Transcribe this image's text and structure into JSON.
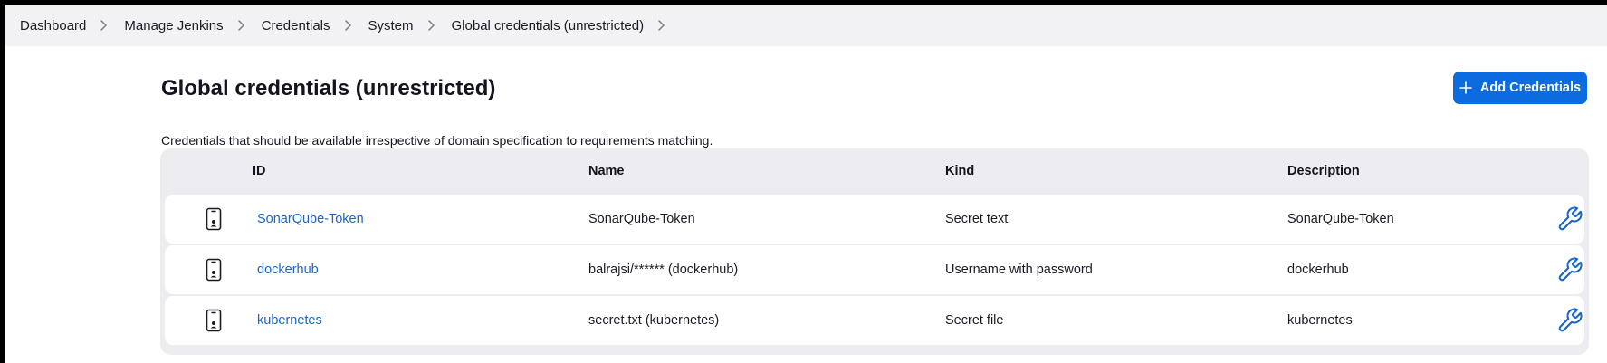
{
  "breadcrumb": {
    "items": [
      {
        "label": "Dashboard"
      },
      {
        "label": "Manage Jenkins"
      },
      {
        "label": "Credentials"
      },
      {
        "label": "System"
      },
      {
        "label": "Global credentials (unrestricted)"
      }
    ]
  },
  "header": {
    "title": "Global credentials (unrestricted)",
    "add_button_label": "Add Credentials",
    "add_button_icon": "plus-icon"
  },
  "description": "Credentials that should be available irrespective of domain specification to requirements matching.",
  "table": {
    "columns": [
      "ID",
      "Name",
      "Kind",
      "Description"
    ],
    "rows": [
      {
        "id": "SonarQube-Token",
        "name": "SonarQube-Token",
        "kind": "Secret text",
        "description": "SonarQube-Token",
        "icon": "credential-phone-icon",
        "action_icon": "wrench-icon"
      },
      {
        "id": "dockerhub",
        "name": "balrajsi/****** (dockerhub)",
        "kind": "Username with password",
        "description": "dockerhub",
        "icon": "credential-phone-icon",
        "action_icon": "wrench-icon"
      },
      {
        "id": "kubernetes",
        "name": "secret.txt (kubernetes)",
        "kind": "Secret file",
        "description": "kubernetes",
        "icon": "credential-phone-icon",
        "action_icon": "wrench-icon"
      }
    ]
  },
  "colors": {
    "accent": "#0b6bdf",
    "link": "#1a66c9",
    "breadcrumb_bg": "#f2f2f4",
    "table_bg": "#ededf1"
  }
}
